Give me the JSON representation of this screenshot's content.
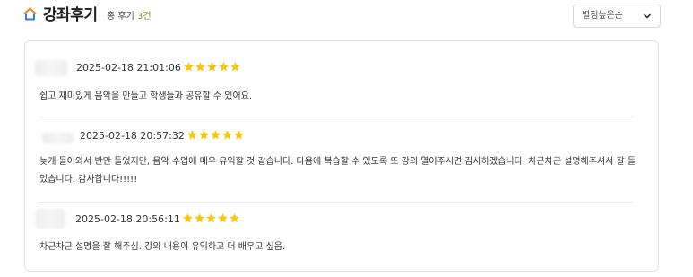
{
  "header": {
    "title": "강좌후기",
    "total_prefix": "총 후기 ",
    "total_count": "3건",
    "sort_selected": "별점높은순"
  },
  "colors": {
    "accent_orange": "#f5811f",
    "accent_blue": "#3a7bd5",
    "star": "#f7c518",
    "count_green": "#7a9b2a"
  },
  "icons": {
    "title": "home-icon",
    "sort": "chevron-down-icon",
    "rating": "star-icon"
  },
  "reviews": [
    {
      "date": "2025-02-18 21:01:06",
      "rating": 5,
      "text": "쉽고 재미있게 음악을 만들고 학생들과 공유할 수 있어요."
    },
    {
      "date": "2025-02-18 20:57:32",
      "rating": 5,
      "text": "늦게 들어와서 반만 들었지만, 음악 수업에 매우 유익할 것 같습니다. 다음에 복습할 수 있도록 또 강의 열어주시면 감사하겠습니다. 차근차근 설명해주셔서 잘 들었습니다. 감사합니다!!!!!"
    },
    {
      "date": "2025-02-18 20:56:11",
      "rating": 5,
      "text": "차근차근 설명을 잘 해주심. 강의 내용이 유익하고 더 배우고 싶음."
    }
  ]
}
